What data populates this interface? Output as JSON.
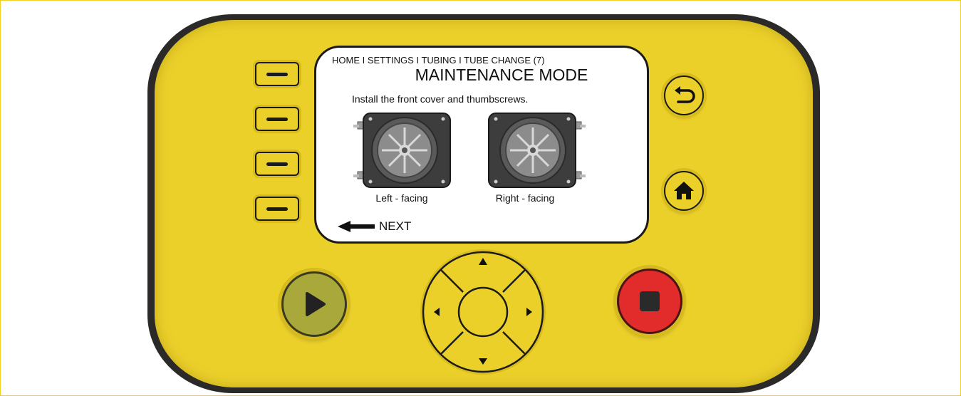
{
  "screen": {
    "breadcrumb": "HOME I SETTINGS I TUBING I TUBE CHANGE (7)",
    "title": "MAINTENANCE MODE",
    "instruction": "Install the front cover and thumbscrews.",
    "pumps": [
      {
        "caption": "Left - facing"
      },
      {
        "caption": "Right - facing"
      }
    ],
    "next_label": "NEXT"
  },
  "controls": {
    "softkeys": [
      "softkey-1",
      "softkey-2",
      "softkey-3",
      "softkey-4"
    ],
    "back_icon": "back-arrow-icon",
    "home_icon": "home-icon",
    "play_icon": "play-icon",
    "stop_icon": "stop-icon",
    "dpad_icons": [
      "up-arrow-icon",
      "left-arrow-icon",
      "right-arrow-icon",
      "down-arrow-icon"
    ]
  },
  "colors": {
    "housing": "#ecd02a",
    "bezel": "#2b2a28",
    "play": "#a9a83a",
    "stop": "#e22b2b"
  }
}
